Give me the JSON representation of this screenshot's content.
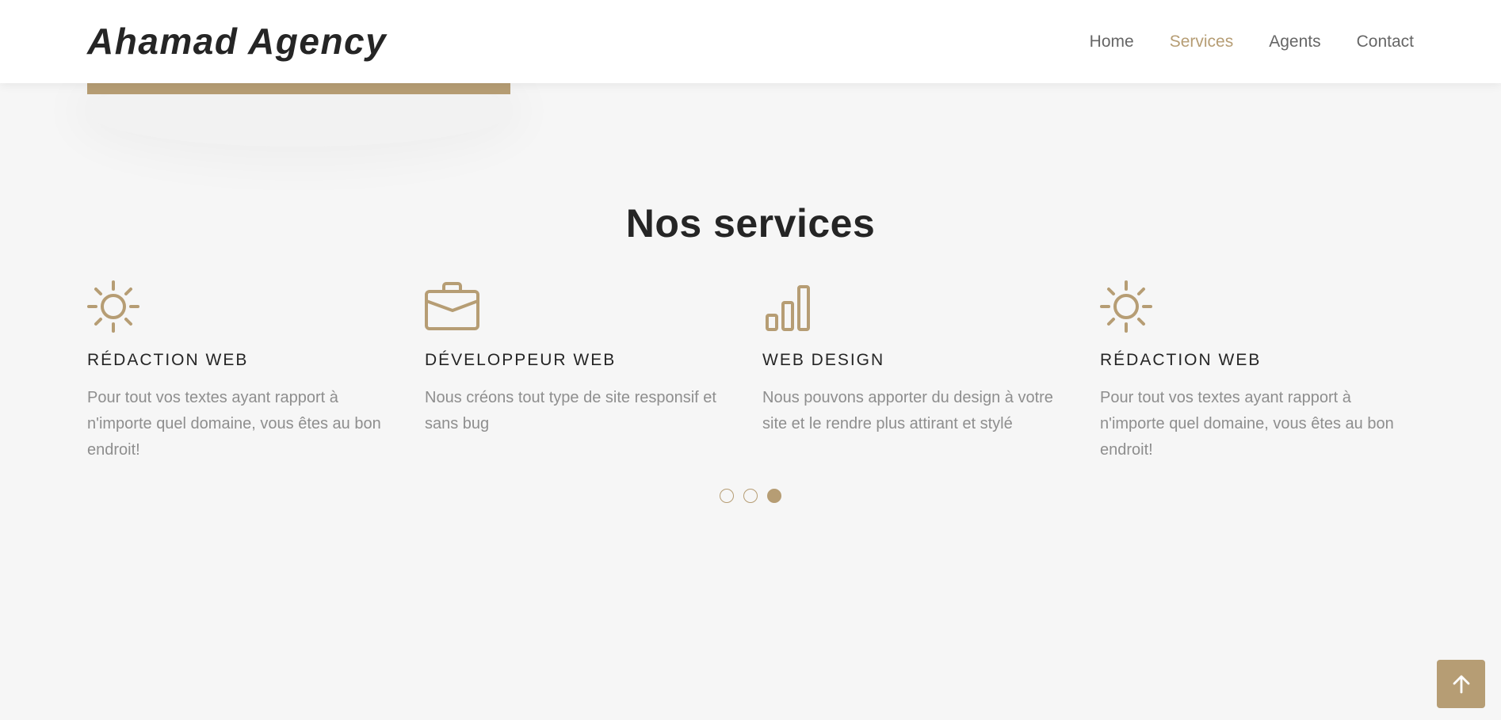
{
  "brand": {
    "name": "Ahamad Agency"
  },
  "nav": {
    "items": [
      {
        "label": "Home"
      },
      {
        "label": "Services"
      },
      {
        "label": "Agents"
      },
      {
        "label": "Contact"
      }
    ],
    "active": "Services"
  },
  "services": {
    "heading": "Nos services",
    "items": [
      {
        "icon": "sun-icon",
        "title": "RÉDACTION WEB",
        "description": "Pour tout vos textes ayant rapport à n'importe quel domaine, vous êtes au bon endroit!"
      },
      {
        "icon": "briefcase-icon",
        "title": "DÉVELOPPEUR WEB",
        "description": "Nous créons tout type de site responsif et sans bug"
      },
      {
        "icon": "bar-chart-icon",
        "title": "WEB DESIGN",
        "description": "Nous pouvons apporter du design à votre site et le rendre plus attirant et stylé"
      },
      {
        "icon": "sun-icon",
        "title": "RÉDACTION WEB",
        "description": "Pour tout vos textes ayant rapport à n'importe quel domaine, vous êtes au bon endroit!"
      }
    ]
  },
  "carousel": {
    "pages": 3,
    "active_page": 3
  },
  "back_to_top": {
    "icon": "arrow-up-icon"
  },
  "colors": {
    "accent": "#b69d74",
    "heading": "#252525",
    "text_muted": "#8e8e8e",
    "nav_text": "#666666",
    "background": "#f6f6f6"
  }
}
